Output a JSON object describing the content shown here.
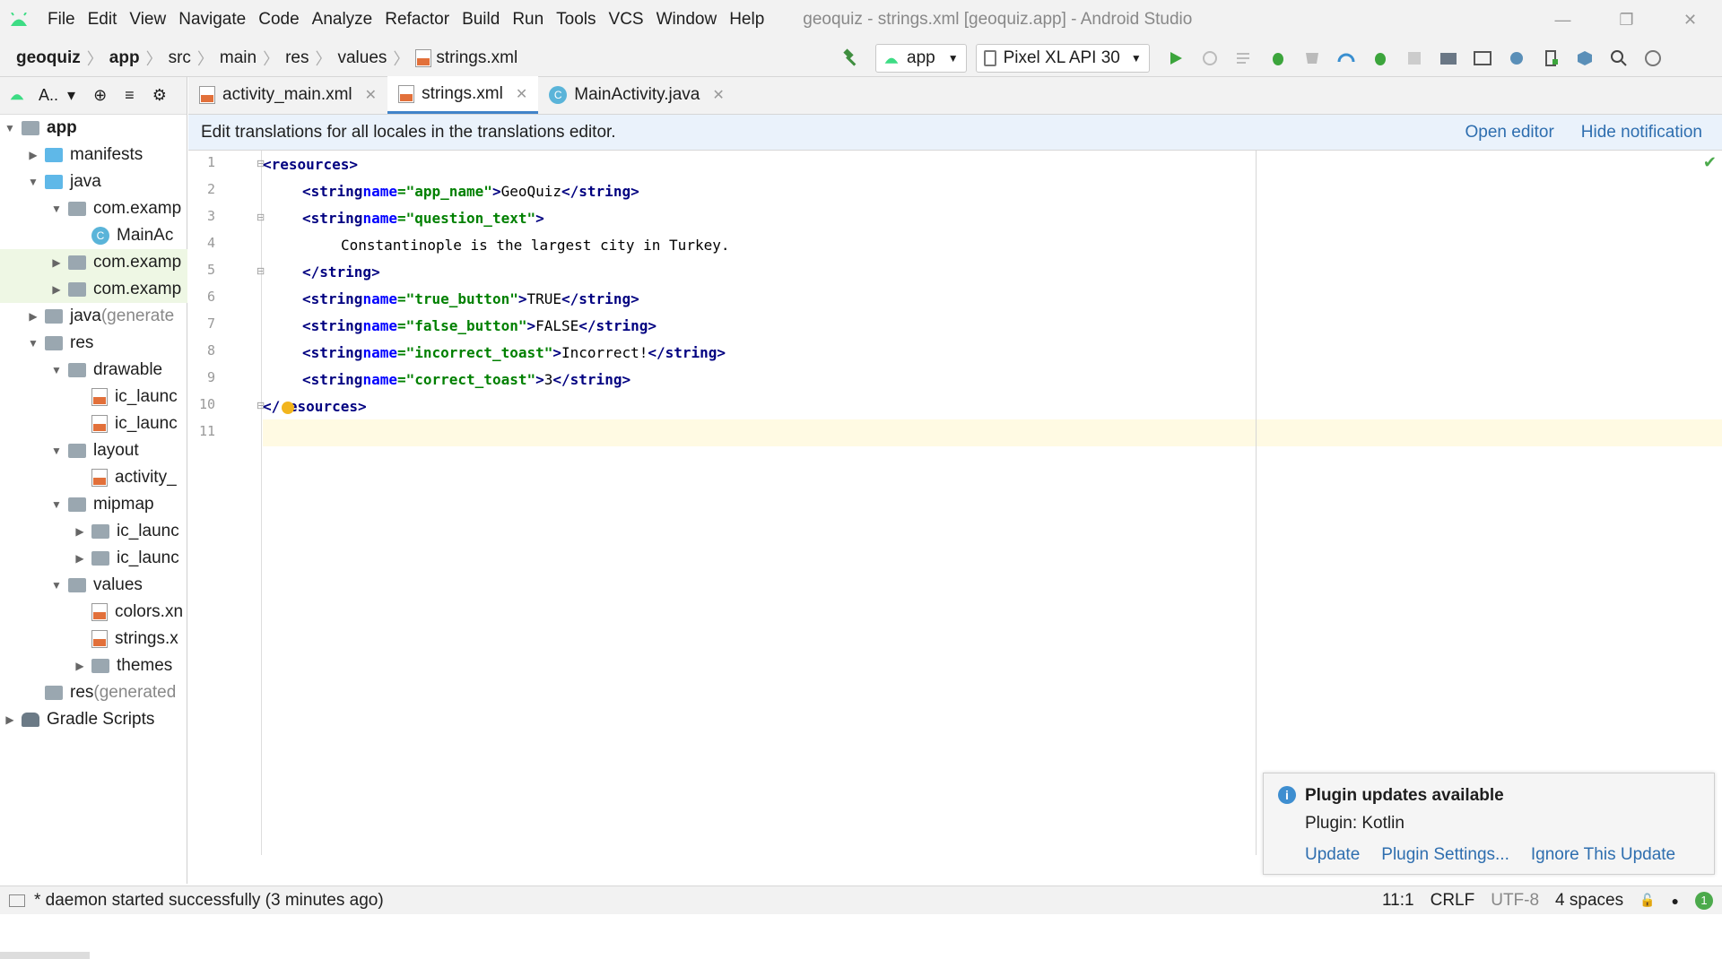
{
  "menu": [
    "File",
    "Edit",
    "View",
    "Navigate",
    "Code",
    "Analyze",
    "Refactor",
    "Build",
    "Run",
    "Tools",
    "VCS",
    "Window",
    "Help"
  ],
  "window_title": "geoquiz - strings.xml [geoquiz.app] - Android Studio",
  "breadcrumbs": [
    "geoquiz",
    "app",
    "src",
    "main",
    "res",
    "values",
    "strings.xml"
  ],
  "toolbar": {
    "config": "app",
    "device": "Pixel XL API 30"
  },
  "sidebar": {
    "view_label": "A.."
  },
  "tree": [
    {
      "label": "app"
    },
    {
      "label": "manifests"
    },
    {
      "label": "java"
    },
    {
      "label": "com.examp"
    },
    {
      "label": "MainAc"
    },
    {
      "label": "com.examp"
    },
    {
      "label": "com.examp"
    },
    {
      "label": "java",
      "suffix": " (generate"
    },
    {
      "label": "res"
    },
    {
      "label": "drawable"
    },
    {
      "label": "ic_launc"
    },
    {
      "label": "ic_launc"
    },
    {
      "label": "layout"
    },
    {
      "label": "activity_"
    },
    {
      "label": "mipmap"
    },
    {
      "label": "ic_launc"
    },
    {
      "label": "ic_launc"
    },
    {
      "label": "values"
    },
    {
      "label": "colors.xn"
    },
    {
      "label": "strings.x"
    },
    {
      "label": "themes"
    },
    {
      "label": "res",
      "suffix": " (generated"
    },
    {
      "label": "Gradle Scripts"
    }
  ],
  "tabs": [
    {
      "label": "activity_main.xml"
    },
    {
      "label": "strings.xml"
    },
    {
      "label": "MainActivity.java"
    }
  ],
  "notification": {
    "message": "Edit translations for all locales in the translations editor.",
    "open": "Open editor",
    "hide": "Hide notification"
  },
  "code_lines": [
    "1",
    "2",
    "3",
    "4",
    "5",
    "6",
    "7",
    "8",
    "9",
    "10",
    "11"
  ],
  "code": {
    "l1": "resources",
    "l2": {
      "tag": "string",
      "attr": "name",
      "val": "\"app_name\"",
      "text": "GeoQuiz"
    },
    "l3": {
      "tag": "string",
      "attr": "name",
      "val": "\"question_text\""
    },
    "l4": "Constantinople is the largest city in Turkey.",
    "l5": "string",
    "l6": {
      "tag": "string",
      "attr": "name",
      "val": "\"true_button\"",
      "text": "TRUE"
    },
    "l7": {
      "tag": "string",
      "attr": "name",
      "val": "\"false_button\"",
      "text": "FALSE"
    },
    "l8": {
      "tag": "string",
      "attr": "name",
      "val": "\"incorrect_toast\"",
      "text": "Incorrect!"
    },
    "l9": {
      "tag": "string",
      "attr": "name",
      "val": "\"correct_toast\"",
      "text": "3"
    },
    "l10": "esources"
  },
  "popup": {
    "title": "Plugin updates available",
    "text": "Plugin: Kotlin",
    "update": "Update",
    "settings": "Plugin Settings...",
    "ignore": "Ignore This Update"
  },
  "status": {
    "message": "* daemon started successfully (3 minutes ago)",
    "position": "11:1",
    "line_sep": "CRLF",
    "encoding": "UTF-8",
    "indent": "4 spaces",
    "badge": "1"
  }
}
